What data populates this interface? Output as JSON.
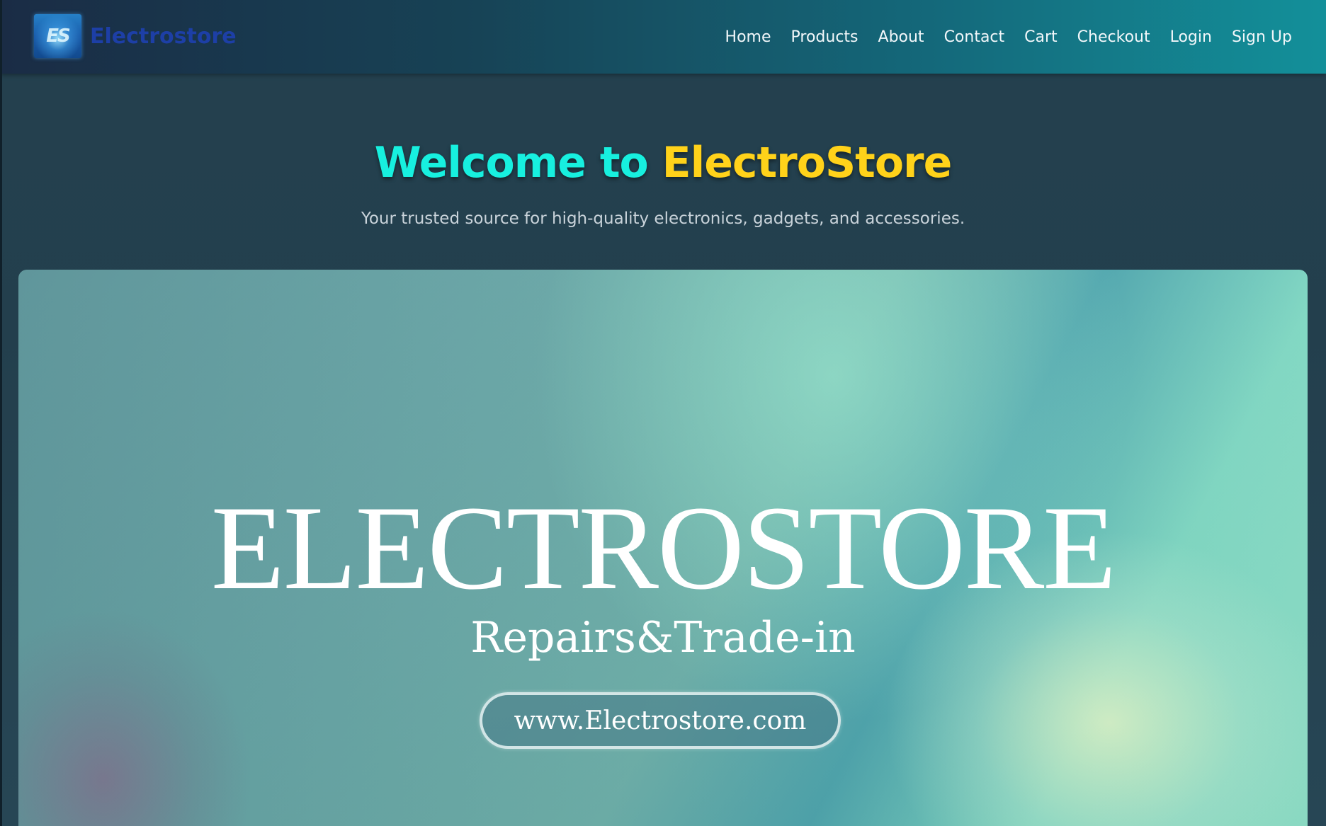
{
  "navbar": {
    "brand": {
      "logo_icon": "es-logo-icon",
      "logo_text": "ES",
      "name": "Electrostore"
    },
    "links": [
      {
        "label": "Home"
      },
      {
        "label": "Products"
      },
      {
        "label": "About"
      },
      {
        "label": "Contact"
      },
      {
        "label": "Cart"
      },
      {
        "label": "Checkout"
      },
      {
        "label": "Login"
      },
      {
        "label": "Sign Up"
      }
    ]
  },
  "hero": {
    "title_part1": "Welcome to ",
    "title_part2": "ElectroStore",
    "subtitle": "Your trusted source for high-quality electronics, gadgets, and accessories."
  },
  "banner": {
    "title": "ELECTROSTORE",
    "tagline": "Repairs&Trade-in",
    "url": "www.Electrostore.com"
  },
  "colors": {
    "title_accent_cyan": "#17f0df",
    "title_accent_yellow": "#ffd21a",
    "brand_name": "#1d3fa6",
    "navbar_start": "#1a2c45",
    "navbar_end": "#13909a",
    "page_background": "#24414f"
  }
}
